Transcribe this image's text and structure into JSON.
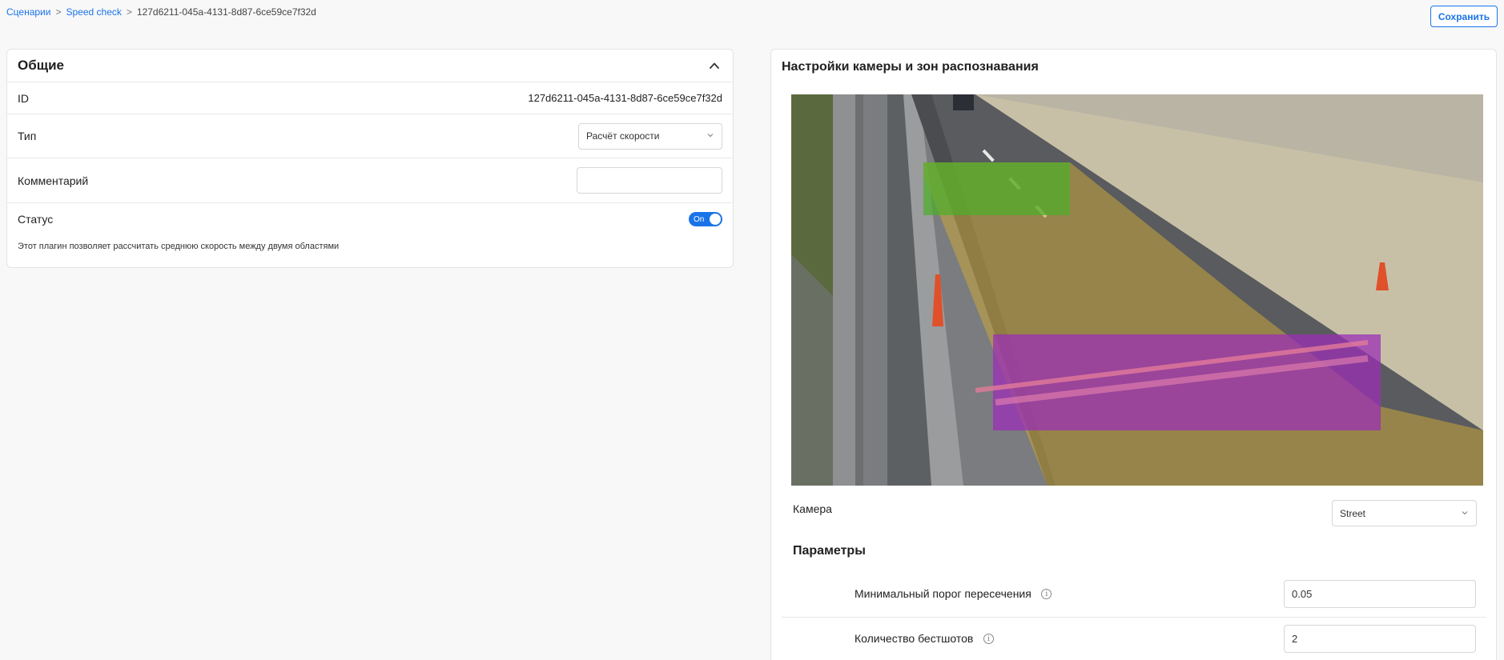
{
  "breadcrumb": {
    "items": [
      "Сценарии",
      "Speed check"
    ],
    "separator": ">",
    "current": "127d6211-045a-4131-8d87-6ce59ce7f32d"
  },
  "toolbar": {
    "save_label": "Сохранить"
  },
  "general": {
    "title": "Общие",
    "id_label": "ID",
    "id_value": "127d6211-045a-4131-8d87-6ce59ce7f32d",
    "type_label": "Тип",
    "type_value": "Расчёт скорости",
    "comment_label": "Комментарий",
    "comment_value": "",
    "status_label": "Статус",
    "status_value": "On",
    "description": "Этот плагин позволяет рассчитать среднюю скорость между двумя областями"
  },
  "camera_settings": {
    "title": "Настройки камеры и зон распознавания",
    "camera_label": "Камера",
    "camera_value": "Street",
    "zones": [
      {
        "name": "green-zone",
        "color": "#4caf2a"
      },
      {
        "name": "yellow-zone",
        "color": "#c9a53a"
      },
      {
        "name": "purple-zone",
        "color": "#9b2fb5"
      }
    ]
  },
  "params": {
    "title": "Параметры",
    "items": [
      {
        "label": "Минимальный порог пересечения",
        "value": "0.05"
      },
      {
        "label": "Количество бестшотов",
        "value": "2"
      }
    ]
  },
  "colors": {
    "accent": "#1a73e8"
  }
}
